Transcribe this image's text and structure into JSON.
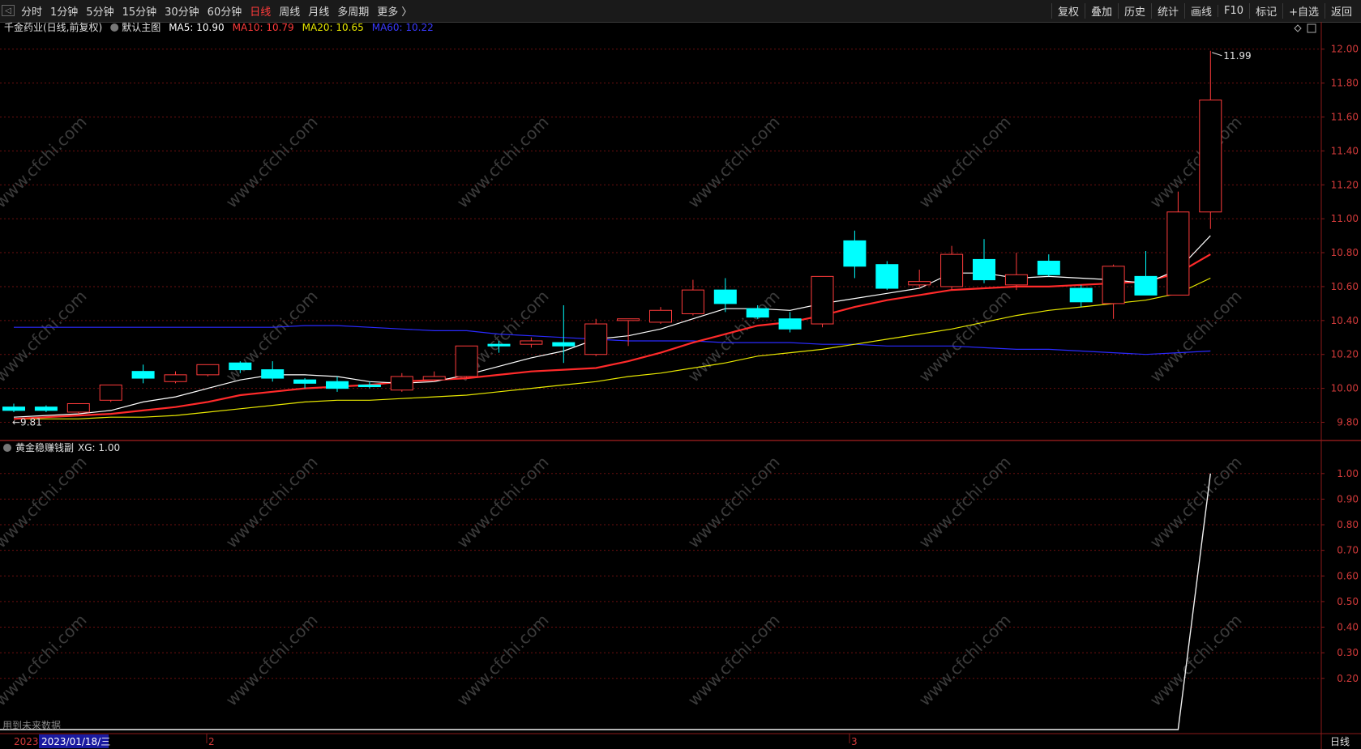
{
  "toolbar": {
    "periods": [
      {
        "label": "分时",
        "active": false
      },
      {
        "label": "1分钟",
        "active": false
      },
      {
        "label": "5分钟",
        "active": false
      },
      {
        "label": "15分钟",
        "active": false
      },
      {
        "label": "30分钟",
        "active": false
      },
      {
        "label": "60分钟",
        "active": false
      },
      {
        "label": "日线",
        "active": true
      },
      {
        "label": "周线",
        "active": false
      },
      {
        "label": "月线",
        "active": false
      },
      {
        "label": "多周期",
        "active": false
      },
      {
        "label": "更多 〉",
        "active": false
      }
    ],
    "tools": [
      "复权",
      "叠加",
      "历史",
      "统计",
      "画线",
      "F10",
      "+自选",
      "返回"
    ],
    "mark_tool": "标记"
  },
  "main_header": {
    "stock": "千金药业(日线,前复权)",
    "template": "默认主图",
    "ma5": "MA5: 10.90",
    "ma10": "MA10: 10.79",
    "ma20": "MA20: 10.65",
    "ma60": "MA60: 10.22"
  },
  "indicator_header": {
    "name": "黄金稳赚钱副",
    "value": "XG: 1.00"
  },
  "footer": {
    "future_note": "用到未来数据",
    "date_label": "2023/01/18/三",
    "year_label": "2023",
    "month_marks": [
      "2",
      "3"
    ],
    "period_tag": "日线"
  },
  "watermark": "www.cfchi.com",
  "chart_data": [
    {
      "type": "candlestick",
      "title": "千金药业(日线,前复权)",
      "ylim": [
        9.75,
        12.07
      ],
      "y_ticks": [
        "12.00",
        "11.80",
        "11.60",
        "11.40",
        "11.20",
        "11.00",
        "10.80",
        "10.60",
        "10.40",
        "10.20",
        "10.00",
        "9.80"
      ],
      "annotations": {
        "high": "11.99",
        "low": "9.81"
      },
      "colors": {
        "up": "#ff3b3b",
        "down": "#00ffff",
        "ma5": "#ffffff",
        "ma10": "#ff2a2a",
        "ma20": "#e8e800",
        "ma60": "#2a2aff"
      },
      "candles": [
        {
          "o": 9.89,
          "h": 9.91,
          "l": 9.86,
          "c": 9.87
        },
        {
          "o": 9.89,
          "h": 9.9,
          "l": 9.86,
          "c": 9.87
        },
        {
          "o": 9.86,
          "h": 9.91,
          "l": 9.85,
          "c": 9.91
        },
        {
          "o": 9.93,
          "h": 10.02,
          "l": 9.92,
          "c": 10.02
        },
        {
          "o": 10.1,
          "h": 10.14,
          "l": 10.03,
          "c": 10.06
        },
        {
          "o": 10.04,
          "h": 10.1,
          "l": 10.03,
          "c": 10.08
        },
        {
          "o": 10.08,
          "h": 10.14,
          "l": 10.07,
          "c": 10.14
        },
        {
          "o": 10.15,
          "h": 10.16,
          "l": 10.09,
          "c": 10.11
        },
        {
          "o": 10.11,
          "h": 10.16,
          "l": 10.04,
          "c": 10.06
        },
        {
          "o": 10.05,
          "h": 10.06,
          "l": 10.0,
          "c": 10.03
        },
        {
          "o": 10.04,
          "h": 10.07,
          "l": 9.98,
          "c": 10.0
        },
        {
          "o": 10.02,
          "h": 10.04,
          "l": 10.0,
          "c": 10.01
        },
        {
          "o": 9.99,
          "h": 10.09,
          "l": 9.98,
          "c": 10.07
        },
        {
          "o": 10.05,
          "h": 10.1,
          "l": 10.04,
          "c": 10.07
        },
        {
          "o": 10.07,
          "h": 10.25,
          "l": 10.06,
          "c": 10.25
        },
        {
          "o": 10.26,
          "h": 10.28,
          "l": 10.21,
          "c": 10.25
        },
        {
          "o": 10.26,
          "h": 10.3,
          "l": 10.24,
          "c": 10.28
        },
        {
          "o": 10.27,
          "h": 10.49,
          "l": 10.15,
          "c": 10.25
        },
        {
          "o": 10.2,
          "h": 10.41,
          "l": 10.19,
          "c": 10.38
        },
        {
          "o": 10.4,
          "h": 10.41,
          "l": 10.25,
          "c": 10.41
        },
        {
          "o": 10.39,
          "h": 10.48,
          "l": 10.38,
          "c": 10.46
        },
        {
          "o": 10.44,
          "h": 10.64,
          "l": 10.43,
          "c": 10.58
        },
        {
          "o": 10.58,
          "h": 10.65,
          "l": 10.45,
          "c": 10.5
        },
        {
          "o": 10.47,
          "h": 10.49,
          "l": 10.41,
          "c": 10.42
        },
        {
          "o": 10.41,
          "h": 10.45,
          "l": 10.33,
          "c": 10.35
        },
        {
          "o": 10.38,
          "h": 10.66,
          "l": 10.36,
          "c": 10.66
        },
        {
          "o": 10.87,
          "h": 10.93,
          "l": 10.65,
          "c": 10.72
        },
        {
          "o": 10.73,
          "h": 10.75,
          "l": 10.58,
          "c": 10.59
        },
        {
          "o": 10.61,
          "h": 10.7,
          "l": 10.59,
          "c": 10.63
        },
        {
          "o": 10.6,
          "h": 10.84,
          "l": 10.58,
          "c": 10.79
        },
        {
          "o": 10.76,
          "h": 10.88,
          "l": 10.62,
          "c": 10.64
        },
        {
          "o": 10.61,
          "h": 10.8,
          "l": 10.58,
          "c": 10.67
        },
        {
          "o": 10.75,
          "h": 10.79,
          "l": 10.66,
          "c": 10.67
        },
        {
          "o": 10.59,
          "h": 10.61,
          "l": 10.48,
          "c": 10.51
        },
        {
          "o": 10.5,
          "h": 10.73,
          "l": 10.41,
          "c": 10.72
        },
        {
          "o": 10.66,
          "h": 10.81,
          "l": 10.55,
          "c": 10.55
        },
        {
          "o": 10.55,
          "h": 11.16,
          "l": 10.55,
          "c": 11.04
        },
        {
          "o": 11.04,
          "h": 11.99,
          "l": 10.94,
          "c": 11.7
        }
      ],
      "ma5": [
        9.83,
        9.84,
        9.85,
        9.87,
        9.92,
        9.95,
        10.0,
        10.05,
        10.08,
        10.08,
        10.07,
        10.04,
        10.03,
        10.04,
        10.08,
        10.13,
        10.18,
        10.22,
        10.29,
        10.31,
        10.35,
        10.41,
        10.47,
        10.47,
        10.46,
        10.5,
        10.53,
        10.56,
        10.59,
        10.68,
        10.68,
        10.65,
        10.66,
        10.65,
        10.64,
        10.62,
        10.7,
        10.9
      ],
      "ma10": [
        9.82,
        9.83,
        9.84,
        9.85,
        9.87,
        9.89,
        9.92,
        9.96,
        9.98,
        10.0,
        10.01,
        10.02,
        10.04,
        10.05,
        10.06,
        10.08,
        10.1,
        10.11,
        10.12,
        10.16,
        10.21,
        10.27,
        10.32,
        10.37,
        10.39,
        10.43,
        10.48,
        10.52,
        10.55,
        10.58,
        10.59,
        10.6,
        10.6,
        10.61,
        10.62,
        10.63,
        10.68,
        10.79
      ],
      "ma20": [
        9.82,
        9.82,
        9.82,
        9.83,
        9.83,
        9.84,
        9.86,
        9.88,
        9.9,
        9.92,
        9.93,
        9.93,
        9.94,
        9.95,
        9.96,
        9.98,
        10.0,
        10.02,
        10.04,
        10.07,
        10.09,
        10.12,
        10.15,
        10.19,
        10.21,
        10.23,
        10.26,
        10.29,
        10.32,
        10.35,
        10.39,
        10.43,
        10.46,
        10.48,
        10.5,
        10.52,
        10.56,
        10.65
      ],
      "ma60": [
        10.36,
        10.36,
        10.36,
        10.36,
        10.36,
        10.36,
        10.36,
        10.36,
        10.36,
        10.37,
        10.37,
        10.36,
        10.35,
        10.34,
        10.34,
        10.32,
        10.31,
        10.3,
        10.29,
        10.28,
        10.28,
        10.28,
        10.27,
        10.27,
        10.27,
        10.26,
        10.26,
        10.25,
        10.25,
        10.25,
        10.24,
        10.23,
        10.23,
        10.22,
        10.21,
        10.2,
        10.21,
        10.22
      ]
    },
    {
      "type": "line",
      "title": "黄金稳赚钱副",
      "series": [
        {
          "name": "XG",
          "values": [
            0,
            0,
            0,
            0,
            0,
            0,
            0,
            0,
            0,
            0,
            0,
            0,
            0,
            0,
            0,
            0,
            0,
            0,
            0,
            0,
            0,
            0,
            0,
            0,
            0,
            0,
            0,
            0,
            0,
            0,
            0,
            0,
            0,
            0,
            0,
            0,
            0,
            1.0
          ]
        }
      ],
      "ylim": [
        0,
        1.05
      ],
      "y_ticks": [
        "1.00",
        "0.90",
        "0.80",
        "0.70",
        "0.60",
        "0.50",
        "0.40",
        "0.30",
        "0.20"
      ]
    }
  ]
}
